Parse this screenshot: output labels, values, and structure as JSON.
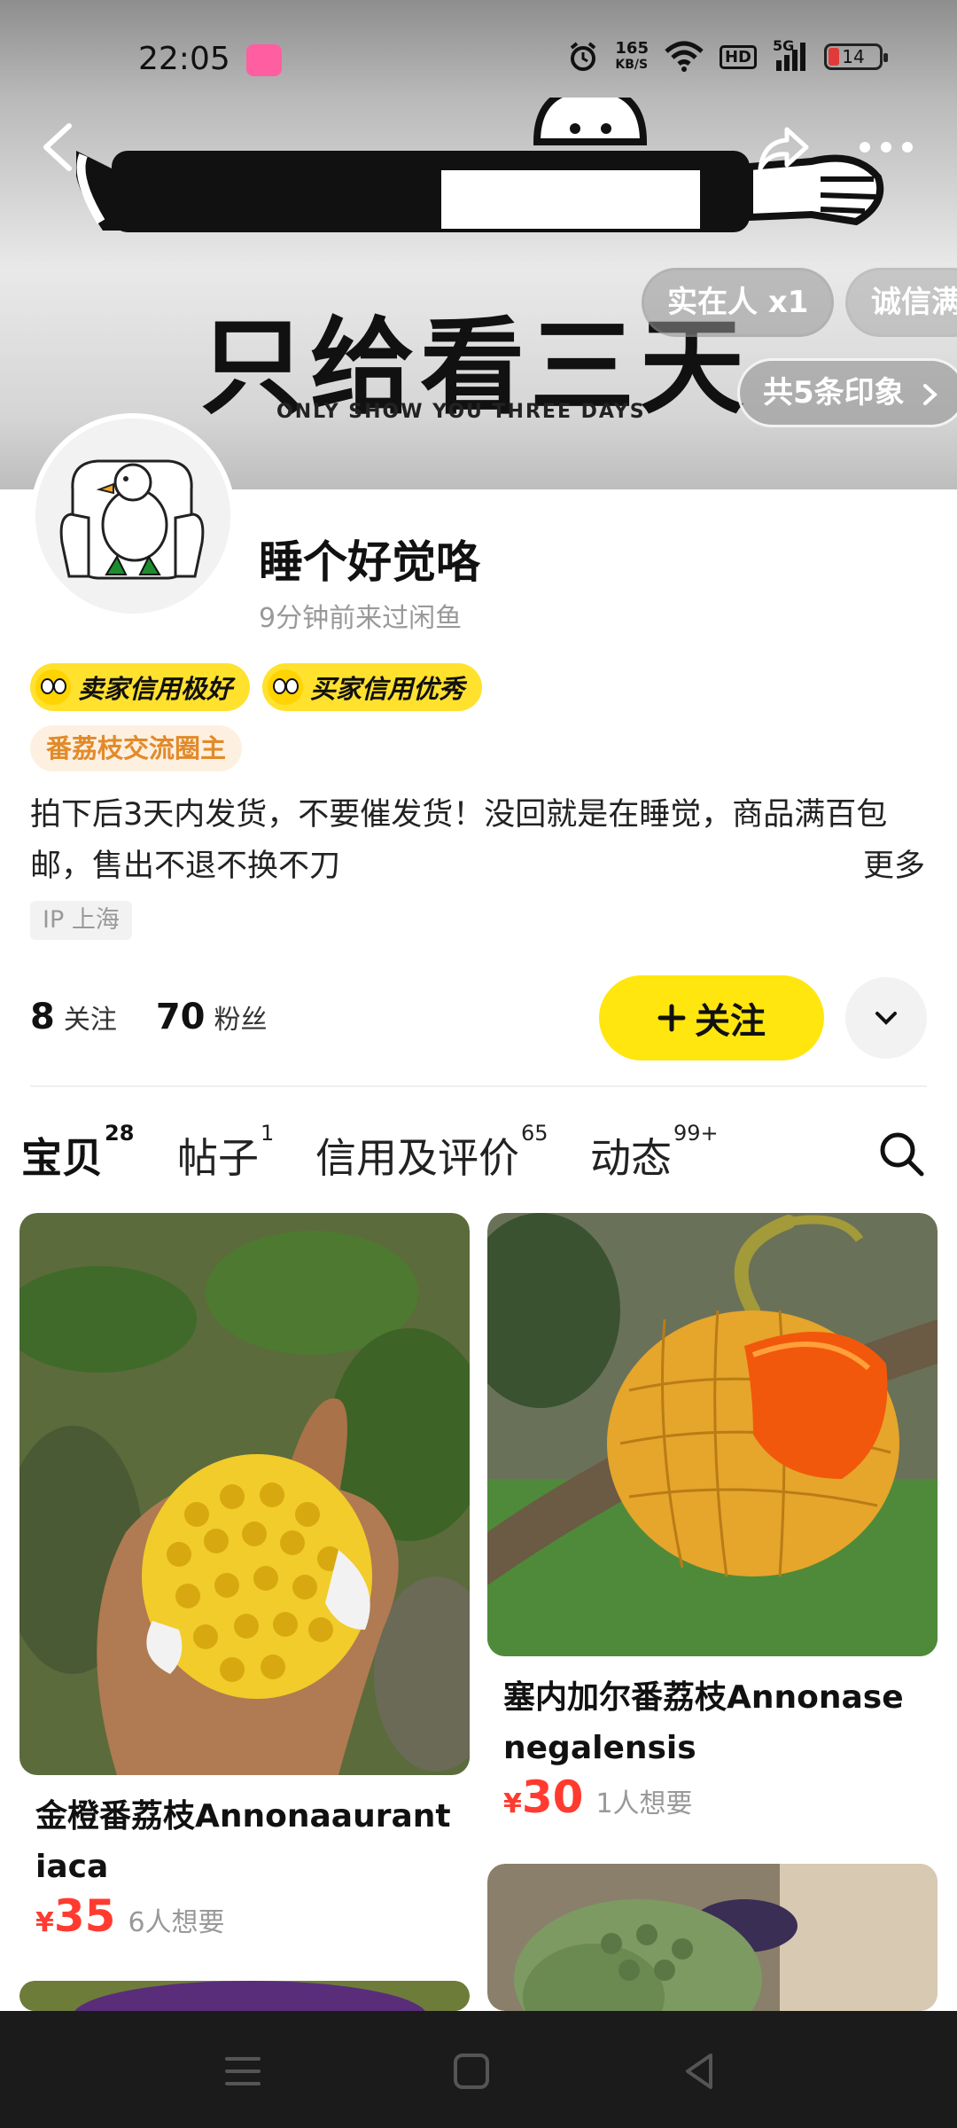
{
  "status_bar": {
    "time": "22:05",
    "net_speed_top": "165",
    "net_speed_bottom": "KB/S",
    "hd_label": "HD",
    "signal_label": "5G",
    "battery": "14"
  },
  "banner": {
    "main_text": "只给看三天",
    "sub_text": "ONLY SHOW YOU THREE DAYS",
    "badge_real_person": "实在人 x1",
    "badge_honest": "诚信满",
    "impressions_label": "共5条印象"
  },
  "profile": {
    "name": "睡个好觉咯",
    "last_seen": "9分钟前来过闲鱼",
    "seller_credit": "卖家信用极好",
    "buyer_credit": "买家信用优秀",
    "circle_tag": "番荔枝交流圈主",
    "bio": "拍下后3天内发货，不要催发货！没回就是在睡觉，商品满百包邮，售出不退不换不刀",
    "bio_more": "更多",
    "ip": "IP 上海",
    "following_count": "8",
    "following_label": "关注",
    "followers_count": "70",
    "followers_label": "粉丝",
    "follow_button": "关注"
  },
  "tabs": [
    {
      "label": "宝贝",
      "count": "28"
    },
    {
      "label": "帖子",
      "count": "1"
    },
    {
      "label": "信用及评价",
      "count": "65"
    },
    {
      "label": "动态",
      "count": "99+"
    }
  ],
  "items": [
    {
      "title": "金橙番荔枝Annonaaurantiaca",
      "currency": "¥",
      "price": "35",
      "wants": "6人想要"
    },
    {
      "title": "塞内加尔番荔枝Annonasenegalensis",
      "currency": "¥",
      "price": "30",
      "wants": "1人想要"
    }
  ],
  "colors": {
    "accent_yellow": "#ffe60f",
    "price_red": "#ff3b30",
    "circle_tag_text": "#e28a2a"
  },
  "icons": [
    "back-icon",
    "share-icon",
    "more-icon",
    "chevron-right-icon",
    "chevron-down-icon",
    "search-icon",
    "plus-icon",
    "menu-icon",
    "home-icon",
    "back-triangle-icon"
  ]
}
